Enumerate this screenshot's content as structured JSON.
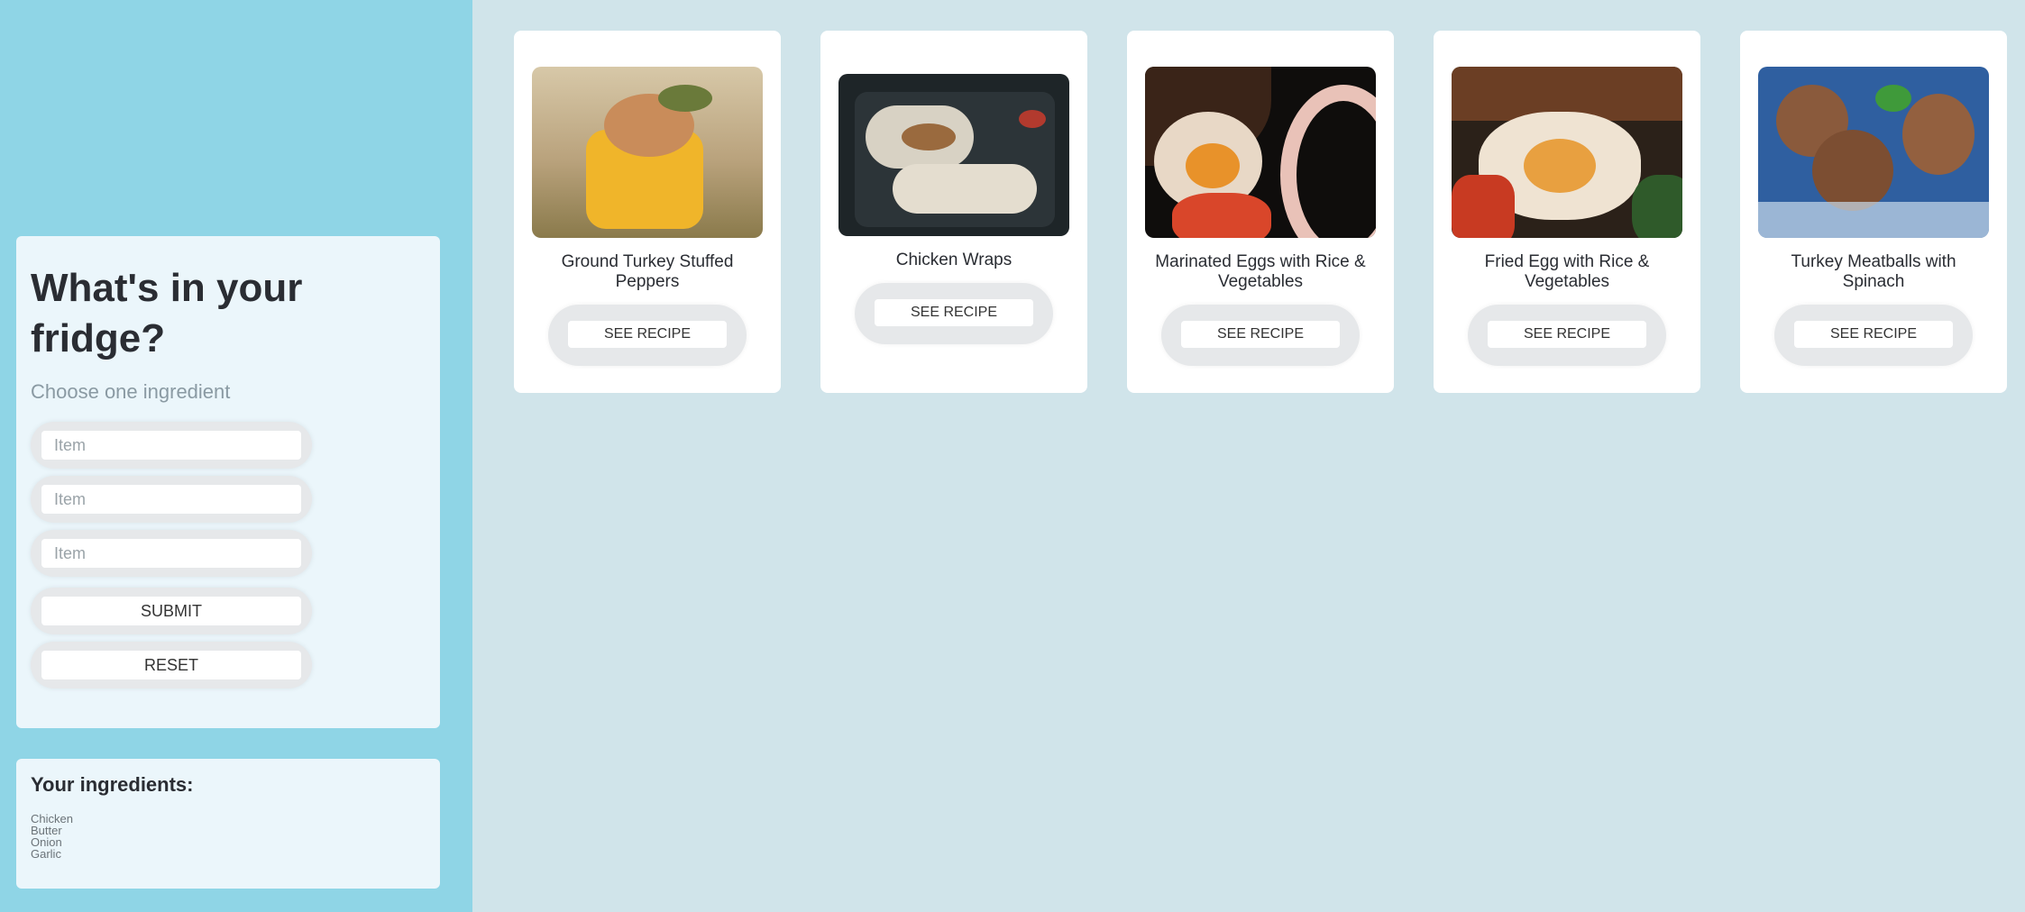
{
  "form": {
    "title": "What's in your fridge?",
    "subtitle": "Choose one ingredient",
    "fields": [
      {
        "placeholder": "Item"
      },
      {
        "placeholder": "Item"
      },
      {
        "placeholder": "Item"
      }
    ],
    "submit_label": "SUBMIT",
    "reset_label": "RESET"
  },
  "ingredients": {
    "title": "Your ingredients:",
    "items": [
      "Chicken",
      "Butter",
      "Onion",
      "Garlic"
    ]
  },
  "recipes": [
    {
      "title": "Ground Turkey Stuffed Peppers",
      "button": "SEE RECIPE",
      "icon": "stuffed-peppers-photo"
    },
    {
      "title": "Chicken Wraps",
      "button": "SEE RECIPE",
      "icon": "wrap-photo"
    },
    {
      "title": "Marinated Eggs with Rice & Vegetables",
      "button": "SEE RECIPE",
      "icon": "eggs-rice-photo"
    },
    {
      "title": "Fried Egg with Rice & Vegetables",
      "button": "SEE RECIPE",
      "icon": "fried-egg-photo"
    },
    {
      "title": "Turkey Meatballs with Spinach",
      "button": "SEE RECIPE",
      "icon": "meatballs-photo"
    }
  ],
  "colors": {
    "sidebar": "#8fd5e6",
    "panel": "#ebf6fb",
    "page_bg": "#d0e4ea"
  }
}
